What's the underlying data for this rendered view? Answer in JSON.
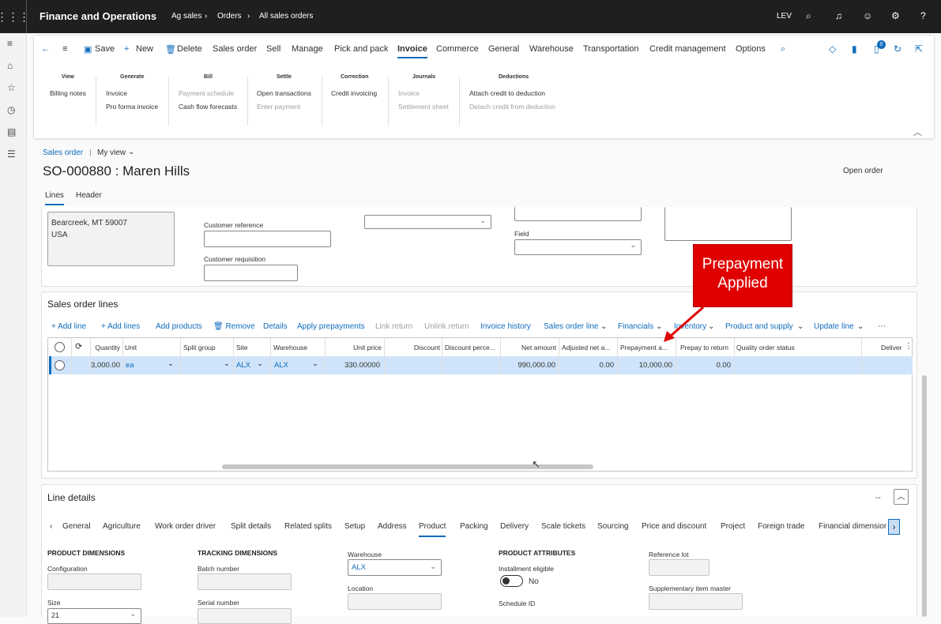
{
  "topbar": {
    "app": "Finance and Operations",
    "crumb1": "Ag sales",
    "crumb2": "Orders",
    "crumb3": "All sales orders",
    "company": "LEV"
  },
  "commands": {
    "save": "Save",
    "new": "New",
    "delete": "Delete",
    "sales_order": "Sales order",
    "sell": "Sell",
    "manage": "Manage",
    "pick_pack": "Pick and pack",
    "invoice": "Invoice",
    "commerce": "Commerce",
    "general": "General",
    "warehouse": "Warehouse",
    "transportation": "Transportation",
    "credit": "Credit management",
    "options": "Options",
    "badge": "0"
  },
  "ribbon": {
    "view_h": "View",
    "billing_notes": "Billing notes",
    "generate_h": "Generate",
    "invoice": "Invoice",
    "pro_forma": "Pro forma invoice",
    "bill_h": "Bill",
    "payment_schedule": "Payment schedule",
    "cash_flow": "Cash flow forecasts",
    "settle_h": "Settle",
    "open_trans": "Open transactions",
    "enter_payment": "Enter payment",
    "correction_h": "Correction",
    "credit_invoicing": "Credit invoicing",
    "journals_h": "Journals",
    "j_invoice": "Invoice",
    "settlement_sheet": "Settlement sheet",
    "deductions_h": "Deductions",
    "attach_credit": "Attach credit to deduction",
    "detach_credit": "Detach credit from deduction"
  },
  "page": {
    "breadcrumb": "Sales order",
    "view": "My view",
    "title": "SO-000880 : Maren Hills",
    "status": "Open order",
    "tab_lines": "Lines",
    "tab_header": "Header"
  },
  "header_fields": {
    "addr1": "Bearcreek, MT 59007",
    "addr2": "USA",
    "customer_reference": "Customer reference",
    "customer_requisition": "Customer requisition",
    "field": "Field"
  },
  "lines": {
    "title": "Sales order lines",
    "add_line": "Add line",
    "add_lines": "Add lines",
    "add_products": "Add products",
    "remove": "Remove",
    "details": "Details",
    "apply_prepayments": "Apply prepayments",
    "link_return": "Link return",
    "unlink_return": "Unlink return",
    "invoice_history": "Invoice history",
    "sales_order_line": "Sales order line",
    "financials": "Financials",
    "inventory": "Inventory",
    "product_supply": "Product and supply",
    "update_line": "Update line",
    "more": "⋯"
  },
  "columns": {
    "quantity": "Quantity",
    "unit": "Unit",
    "split_group": "Split group",
    "site": "Site",
    "warehouse": "Warehouse",
    "unit_price": "Unit price",
    "discount": "Discount",
    "discount_pct": "Discount perce...",
    "net_amount": "Net amount",
    "adj_net": "Adjusted net a...",
    "prepayment": "Prepayment a...",
    "prepay_return": "Prepay to return",
    "quality": "Quality order status",
    "delivery": "Deliver"
  },
  "row": {
    "quantity": "3,000.00",
    "unit": "ea",
    "site": "ALX",
    "warehouse": "ALX",
    "unit_price": "330.00000",
    "net_amount": "990,000.00",
    "adj_net": "0.00",
    "prepayment": "10,000.00",
    "prepay_return": "0.00"
  },
  "callout": {
    "line1": "Prepayment",
    "line2": "Applied"
  },
  "details": {
    "title": "Line details",
    "collapse": "--",
    "tabs": [
      "General",
      "Agriculture",
      "Work order driver",
      "Split details",
      "Related splits",
      "Setup",
      "Address",
      "Product",
      "Packing",
      "Delivery",
      "Scale tickets",
      "Sourcing",
      "Price and discount",
      "Project",
      "Foreign trade",
      "Financial dimension"
    ],
    "prod_dim_h": "PRODUCT DIMENSIONS",
    "configuration": "Configuration",
    "size": "Size",
    "size_value": "21",
    "track_h": "TRACKING DIMENSIONS",
    "batch": "Batch number",
    "serial": "Serial number",
    "warehouse": "Warehouse",
    "warehouse_value": "ALX",
    "location": "Location",
    "attr_h": "PRODUCT ATTRIBUTES",
    "installment": "Installment eligible",
    "installment_value": "No",
    "schedule": "Schedule ID",
    "ref_lot": "Reference lot",
    "supp_item": "Supplementary item master"
  }
}
